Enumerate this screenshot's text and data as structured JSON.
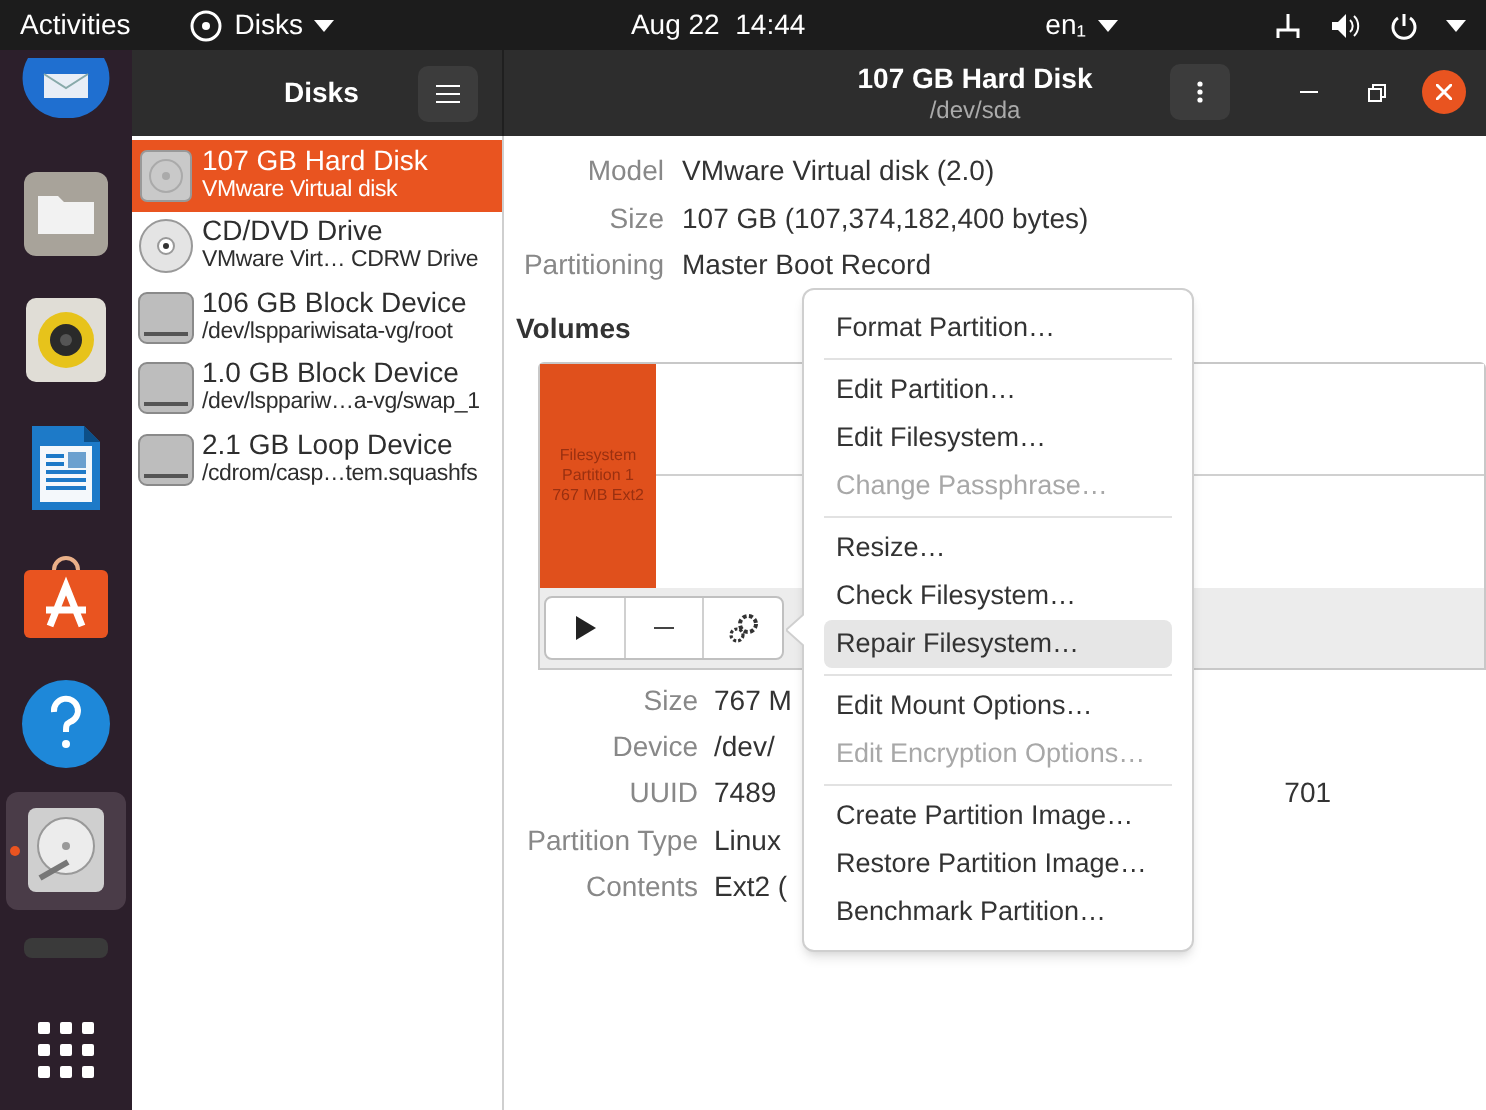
{
  "top_bar": {
    "activities": "Activities",
    "app_menu": "Disks",
    "clock": "Aug 22  14:44",
    "input_method": "en₁"
  },
  "dock": [
    {
      "kind": "mail",
      "selected": false
    },
    {
      "kind": "files",
      "selected": false
    },
    {
      "kind": "music",
      "selected": false
    },
    {
      "kind": "writer",
      "selected": false
    },
    {
      "kind": "software",
      "selected": false
    },
    {
      "kind": "help",
      "selected": false
    },
    {
      "kind": "disks",
      "selected": true
    },
    {
      "kind": "terminal",
      "selected": false
    },
    {
      "kind": "grid",
      "selected": false
    }
  ],
  "sidebar": {
    "title": "Disks",
    "items": [
      {
        "kind": "hdd",
        "title": "107 GB Hard Disk",
        "subtitle": "VMware Virtual disk",
        "selected": true
      },
      {
        "kind": "optical",
        "title": "CD/DVD Drive",
        "subtitle": "VMware Virt… CDRW Drive",
        "selected": false
      },
      {
        "kind": "block",
        "title": "106 GB Block Device",
        "subtitle": "/dev/lsppariwisata-vg/root",
        "selected": false
      },
      {
        "kind": "block",
        "title": "1.0 GB Block Device",
        "subtitle": "/dev/lsppariw…a-vg/swap_1",
        "selected": false
      },
      {
        "kind": "block",
        "title": "2.1 GB Loop Device",
        "subtitle": "/cdrom/casp…tem.squashfs",
        "selected": false
      }
    ]
  },
  "header": {
    "title": "107 GB Hard Disk",
    "subtitle": "/dev/sda"
  },
  "disk_info": [
    {
      "label": "Model",
      "value": "VMware Virtual disk (2.0)"
    },
    {
      "label": "Size",
      "value": "107 GB (107,374,182,400 bytes)"
    },
    {
      "label": "Partitioning",
      "value": "Master Boot Record"
    }
  ],
  "volumes": {
    "title": "Volumes",
    "partitions": [
      {
        "lines": [
          "Filesystem",
          "Partition 1",
          "767 MB Ext2"
        ],
        "selected": true
      }
    ],
    "details": [
      {
        "label": "Size",
        "value": "767 M"
      },
      {
        "label": "Device",
        "value": "/dev/"
      },
      {
        "label": "UUID",
        "value": "7489",
        "value_tail": "701"
      },
      {
        "label": "Partition Type",
        "value": "Linux"
      },
      {
        "label": "Contents",
        "value": "Ext2 ("
      }
    ]
  },
  "menu": [
    [
      {
        "label": "Format Partition…",
        "disabled": false,
        "selected": false
      }
    ],
    [
      {
        "label": "Edit Partition…",
        "disabled": false,
        "selected": false
      },
      {
        "label": "Edit Filesystem…",
        "disabled": false,
        "selected": false
      },
      {
        "label": "Change Passphrase…",
        "disabled": true,
        "selected": false
      }
    ],
    [
      {
        "label": "Resize…",
        "disabled": false,
        "selected": false
      },
      {
        "label": "Check Filesystem…",
        "disabled": false,
        "selected": false
      },
      {
        "label": "Repair Filesystem…",
        "disabled": false,
        "selected": true
      }
    ],
    [
      {
        "label": "Edit Mount Options…",
        "disabled": false,
        "selected": false
      },
      {
        "label": "Edit Encryption Options…",
        "disabled": true,
        "selected": false
      }
    ],
    [
      {
        "label": "Create Partition Image…",
        "disabled": false,
        "selected": false
      },
      {
        "label": "Restore Partition Image…",
        "disabled": false,
        "selected": false
      },
      {
        "label": "Benchmark Partition…",
        "disabled": false,
        "selected": false
      }
    ]
  ]
}
